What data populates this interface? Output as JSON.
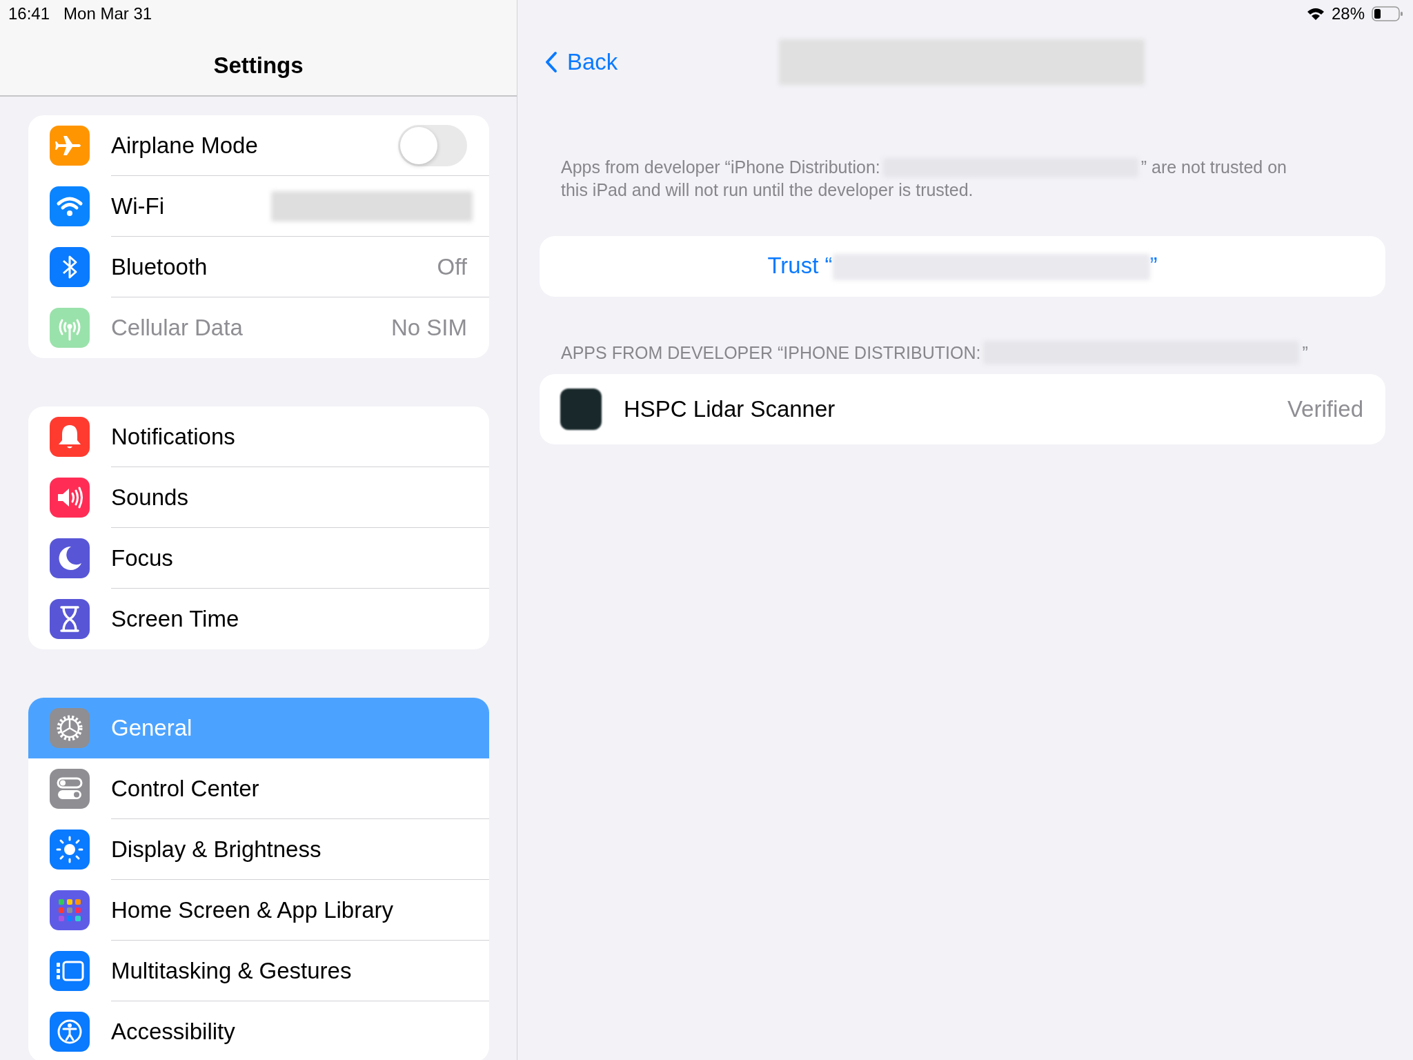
{
  "status_bar": {
    "time": "16:41",
    "date": "Mon Mar 31",
    "battery": "28%"
  },
  "sidebar": {
    "title": "Settings",
    "groups": [
      {
        "items": [
          {
            "label": "Airplane Mode",
            "kind": "toggle",
            "on": false,
            "disabled": false,
            "selected": false,
            "color": "#ff9500"
          },
          {
            "label": "Wi-Fi",
            "kind": "blurred",
            "disabled": false,
            "selected": false,
            "color": "#0a84ff"
          },
          {
            "label": "Bluetooth",
            "kind": "value",
            "value": "Off",
            "disabled": false,
            "selected": false,
            "color": "#0a7aff"
          },
          {
            "label": "Cellular Data",
            "kind": "value",
            "value": "No SIM",
            "disabled": true,
            "selected": false,
            "color": "#9ae2ab"
          }
        ]
      },
      {
        "items": [
          {
            "label": "Notifications",
            "kind": "plain",
            "disabled": false,
            "selected": false,
            "color": "#ff3b30"
          },
          {
            "label": "Sounds",
            "kind": "plain",
            "disabled": false,
            "selected": false,
            "color": "#ff2d55"
          },
          {
            "label": "Focus",
            "kind": "plain",
            "disabled": false,
            "selected": false,
            "color": "#5856d6"
          },
          {
            "label": "Screen Time",
            "kind": "plain",
            "disabled": false,
            "selected": false,
            "color": "#5856d6"
          }
        ]
      },
      {
        "items": [
          {
            "label": "General",
            "kind": "plain",
            "disabled": false,
            "selected": true,
            "color": "#8e8e93"
          },
          {
            "label": "Control Center",
            "kind": "plain",
            "disabled": false,
            "selected": false,
            "color": "#8e8e93"
          },
          {
            "label": "Display & Brightness",
            "kind": "plain",
            "disabled": false,
            "selected": false,
            "color": "#0a7aff"
          },
          {
            "label": "Home Screen & App Library",
            "kind": "plain",
            "disabled": false,
            "selected": false,
            "color": "#5e5ce6"
          },
          {
            "label": "Multitasking & Gestures",
            "kind": "plain",
            "disabled": false,
            "selected": false,
            "color": "#0a7aff"
          },
          {
            "label": "Accessibility",
            "kind": "plain",
            "disabled": false,
            "selected": false,
            "color": "#0a7aff"
          }
        ]
      }
    ]
  },
  "detail": {
    "back": "Back",
    "description_start": "Apps from developer “iPhone Distribution:",
    "description_end": "” are not trusted on",
    "description_line_2": "this iPad and will not run until the developer is trusted.",
    "trust_button_start": "Trust “",
    "trust_button_end": "”",
    "section_header_start": "APPS FROM DEVELOPER “IPHONE DISTRIBUTION:",
    "section_header_end": "”",
    "apps": [
      {
        "name": "HSPC Lidar Scanner",
        "status": "Verified"
      }
    ]
  }
}
